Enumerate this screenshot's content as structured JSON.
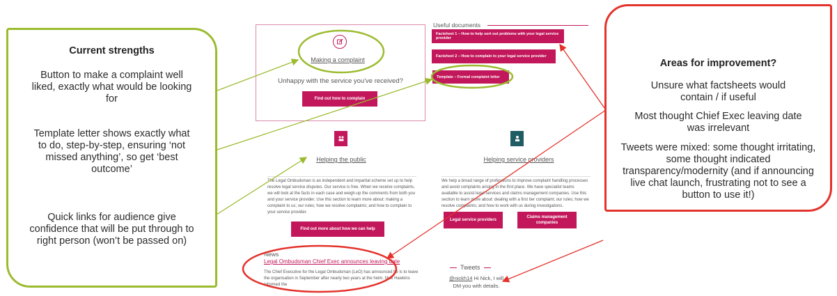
{
  "strengths": {
    "title": "Current strengths",
    "points": [
      "Button to make a complaint well liked, exactly what would be looking for",
      "Template letter shows exactly what to do, step-by-step, ensuring ‘not missed anything’, so get ‘best outcome’",
      "Quick links for audience give confidence that will be put through to right person (won’t be passed on)"
    ]
  },
  "improvements": {
    "title": "Areas for improvement?",
    "points": [
      "Unsure what factsheets would contain / if useful",
      "Most thought Chief Exec leaving date was irrelevant",
      "Tweets were mixed: some thought irritating, some thought indicated transparency/modernity (and if announcing live chat launch, frustrating not to see a button to use it!)"
    ]
  },
  "site": {
    "complaint": {
      "heading": "Making a complaint",
      "question": "Unhappy with the service you've received?",
      "button": "Find out how to complain"
    },
    "useful_documents": {
      "heading": "Useful documents",
      "items": [
        "Factsheet 1 – How to help sort out problems with your legal service provider",
        "Factsheet 2 – How to complain to your legal service provider",
        "Template – Formal complaint letter"
      ]
    },
    "public": {
      "heading": "Helping the public",
      "body": "The Legal Ombudsman is an independent and impartial scheme set up to help resolve legal service disputes. Our service is free. When we receive complaints, we will look at the facts in each case and weigh-up the comments from both you and your service provider. Use this section to learn more about: making a complaint to us; our rules; how we resolve complaints; and how to complain to your service provider.",
      "button": "Find out more about how we can help"
    },
    "providers": {
      "heading": "Helping service providers",
      "body": "We help a broad range of professions to improve complaint handling processes and avoid complaints arising in the first place. We have specialist teams available to assist legal services and claims management companies. Use this section to learn more about: dealing with a first tier complaint; our rules; how we resolve complaints; and how to work with us during investigations.",
      "button_legal": "Legal service providers",
      "button_claims": "Claims management companies"
    },
    "news": {
      "heading": "News",
      "headline": "Legal Ombudsman Chief Exec announces leaving date",
      "body": "The Chief Executive for the Legal Ombudsman (LeO) has announced he is to leave the organisation in September after nearly two years at the helm. Nick Hawkins informed the"
    },
    "tweets": {
      "heading": "Tweets",
      "handle": "@nickh14",
      "text": "Hi Nick, I will DM you with details."
    }
  },
  "colors": {
    "green": "#9bbb2f",
    "red": "#e3322b",
    "magenta": "#c2185b",
    "teal": "#1f5c63"
  }
}
